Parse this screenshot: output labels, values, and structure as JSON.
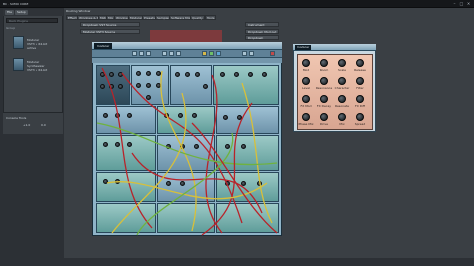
{
  "app": {
    "title": "BC · SUMO CORE"
  },
  "window_controls": {
    "minimize": "–",
    "maximize": "□",
    "close": "✕"
  },
  "left_panel": {
    "toolbar": [
      "File",
      "Setup"
    ],
    "search_placeholder": "Rack Plugins",
    "tree_label": "Group",
    "items": [
      {
        "line1": "Modular",
        "line2": "VST3 • 64-bit",
        "line3": "active"
      },
      {
        "line1": "Modular",
        "line2": "Synthesizer",
        "line3": "VST3 • 64-bit"
      }
    ],
    "bottom": {
      "title": "Console Tools",
      "value_a": "+1.0",
      "value_b": "0.0"
    }
  },
  "rack": {
    "header": "Routing Window",
    "tabs": [
      "Effects",
      "Windows & Mix",
      "Midi",
      "Mix",
      "Windows",
      "Modular",
      "Presets",
      "Sampler",
      "Software Mix",
      "Quality",
      "Tools"
    ],
    "fields": [
      "Dropdown VST Source",
      "Modular VST3 Source",
      "Instrument",
      "Dropdown Mod out",
      "Dropdown"
    ]
  },
  "modular": {
    "logo": "modular",
    "modules": 18
  },
  "fx": {
    "logo": "modular",
    "knobs": [
      [
        "Mod",
        "Room",
        "Scale",
        "Release"
      ],
      [
        "Level",
        "Resonance",
        "Character",
        "Filter"
      ],
      [
        "FX Mod",
        "FX Decay",
        "Resonate",
        "FX Diff"
      ],
      [
        "Phase Mix",
        "Drive",
        "Mix",
        "Spread"
      ]
    ]
  },
  "colors": {
    "cable_red": "#b8232a",
    "cable_yellow": "#d8c03a",
    "cable_green": "#6fb23f",
    "fx_bg": "#e9b9a3"
  }
}
